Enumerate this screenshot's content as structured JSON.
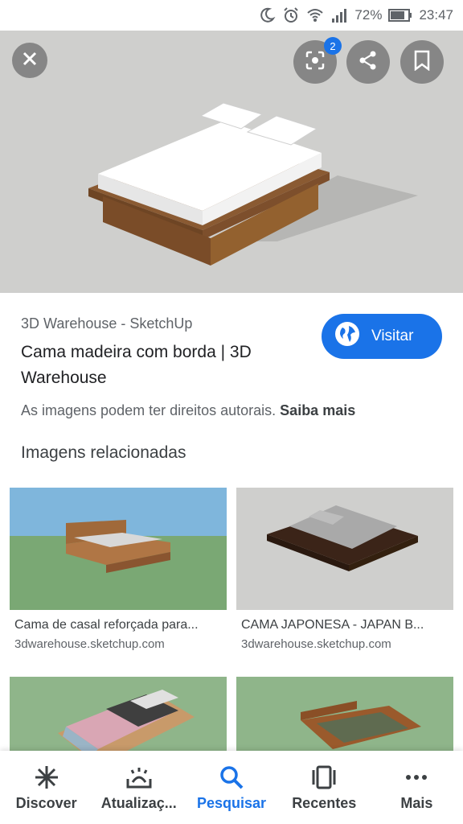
{
  "status_bar": {
    "battery_percent": "72%",
    "time": "23:47",
    "icons": [
      "do-not-disturb-icon",
      "alarm-icon",
      "wifi-icon",
      "signal-icon",
      "battery-icon"
    ]
  },
  "hero": {
    "lens_badge": "2",
    "buttons": [
      "close-icon",
      "lens-icon",
      "share-icon",
      "bookmark-icon"
    ]
  },
  "result": {
    "source": "3D Warehouse - SketchUp",
    "title": "Cama madeira com borda | 3D Warehouse",
    "visit_label": "Visitar",
    "copyright_text": "As imagens podem ter direitos autorais.",
    "learn_more": "Saiba mais"
  },
  "related": {
    "heading": "Imagens relacionadas",
    "items": [
      {
        "title": "Cama de casal reforçada para...",
        "domain": "3dwarehouse.sketchup.com"
      },
      {
        "title": "CAMA JAPONESA - JAPAN B...",
        "domain": "3dwarehouse.sketchup.com"
      },
      {
        "title": "",
        "domain": ""
      },
      {
        "title": "",
        "domain": ""
      }
    ]
  },
  "bottom_nav": {
    "items": [
      {
        "label": "Discover",
        "icon": "asterisk-icon"
      },
      {
        "label": "Atualizaç...",
        "icon": "updates-icon"
      },
      {
        "label": "Pesquisar",
        "icon": "search-icon"
      },
      {
        "label": "Recentes",
        "icon": "recents-icon"
      },
      {
        "label": "Mais",
        "icon": "more-icon"
      }
    ],
    "active_color": "#1a73e8"
  }
}
